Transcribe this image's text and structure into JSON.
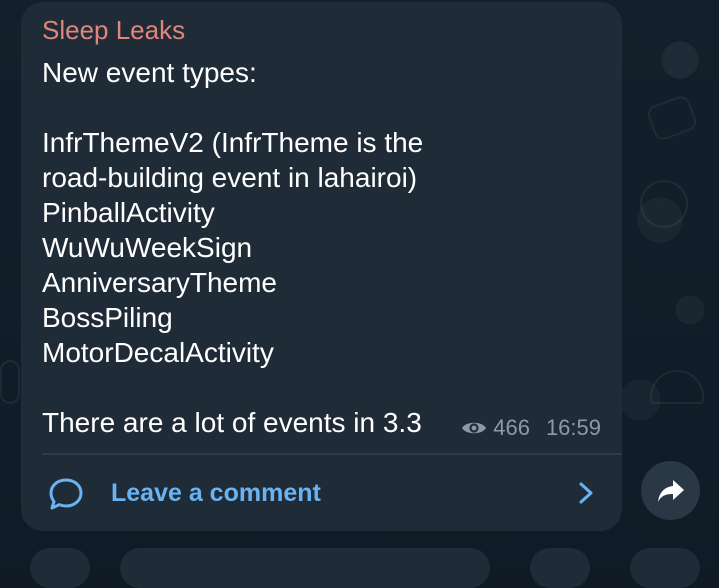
{
  "post": {
    "channel_name": "Sleep Leaks",
    "text_lines": [
      "New event types:",
      "",
      "InfrThemeV2 (InfrTheme is the",
      "road-building event in lahairoi)",
      "PinballActivity",
      "WuWuWeekSign",
      "AnniversaryTheme",
      "BossPiling",
      "MotorDecalActivity",
      "",
      "There are a lot of events in 3.3"
    ],
    "views": "466",
    "time": "16:59",
    "comment_label": "Leave a comment"
  },
  "colors": {
    "bubble": "#1f2c38",
    "channel_name": "#e0857a",
    "link": "#6ab3f3",
    "meta": "#8a9aaa"
  },
  "icons": {
    "views": "eye-icon",
    "comment": "comment-bubble-icon",
    "open": "chevron-right-icon",
    "share": "share-arrow-icon"
  }
}
